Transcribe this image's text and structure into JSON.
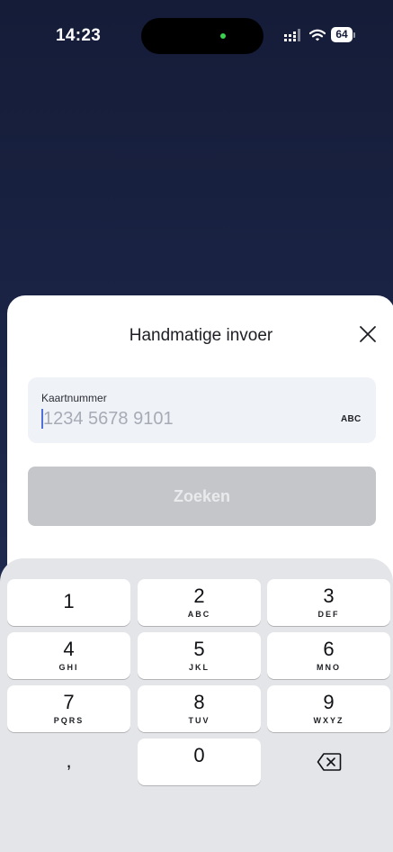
{
  "status_bar": {
    "time": "14:23",
    "battery": "64"
  },
  "sheet": {
    "title": "Handmatige invoer",
    "close_icon": "close-icon"
  },
  "card_input": {
    "label": "Kaartnummer",
    "placeholder": "1234 5678 9101",
    "value": "",
    "keyboard_toggle": "ABC"
  },
  "search_button": {
    "label": "Zoeken"
  },
  "keypad": {
    "keys": [
      {
        "digit": "1",
        "letters": ""
      },
      {
        "digit": "2",
        "letters": "ABC"
      },
      {
        "digit": "3",
        "letters": "DEF"
      },
      {
        "digit": "4",
        "letters": "GHI"
      },
      {
        "digit": "5",
        "letters": "JKL"
      },
      {
        "digit": "6",
        "letters": "MNO"
      },
      {
        "digit": "7",
        "letters": "PQRS"
      },
      {
        "digit": "8",
        "letters": "TUV"
      },
      {
        "digit": "9",
        "letters": "WXYZ"
      }
    ],
    "comma": ",",
    "zero": "0",
    "backspace_icon": "backspace-icon"
  },
  "colors": {
    "background_top": "#151c38",
    "background_bottom": "#243058",
    "input_background": "#eff2f7",
    "button_disabled": "#c4c6c9",
    "keypad_background": "#e4e5e9",
    "island_indicator": "#3ad14e"
  }
}
